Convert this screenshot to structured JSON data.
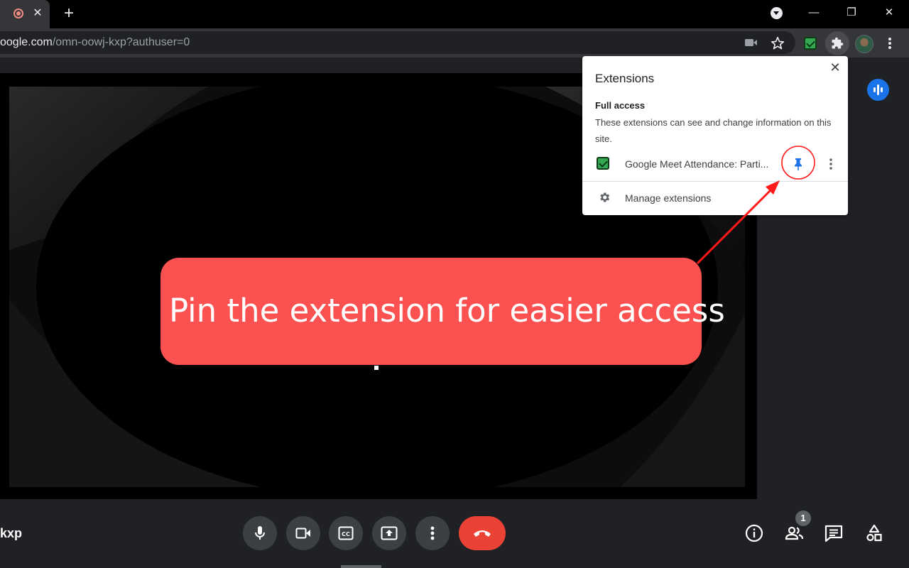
{
  "browser": {
    "tab_close_glyph": "✕",
    "new_tab_glyph": "+",
    "window": {
      "minimize": "—",
      "restore": "❐",
      "close": "✕"
    },
    "url_host": "oogle.com",
    "url_path": "/omn-oowj-kxp?authuser=0"
  },
  "extensions_popup": {
    "title": "Extensions",
    "close_glyph": "✕",
    "section_title": "Full access",
    "section_description": "These extensions can see and change information on this site.",
    "item_name": "Google Meet Attendance: Parti...",
    "manage_label": "Manage extensions"
  },
  "callout": {
    "text": "Pin the extension for easier access",
    "color": "#fb5151"
  },
  "meet": {
    "meeting_code": "kxp",
    "participants_count": "1"
  },
  "icons": {
    "toolbar": [
      "video-camera-icon",
      "star-icon",
      "green-check-extension-icon",
      "puzzle-icon",
      "avatar",
      "kebab-menu-icon"
    ],
    "controls": [
      "microphone-icon",
      "camera-icon",
      "captions-icon",
      "present-icon",
      "more-options-icon",
      "end-call-icon"
    ],
    "right_panel": [
      "info-icon",
      "people-icon",
      "chat-icon",
      "activities-icon"
    ]
  },
  "colors": {
    "accent_blue": "#1a73e8",
    "end_call_red": "#ea4335",
    "arrow_red": "#ff1a1a"
  }
}
